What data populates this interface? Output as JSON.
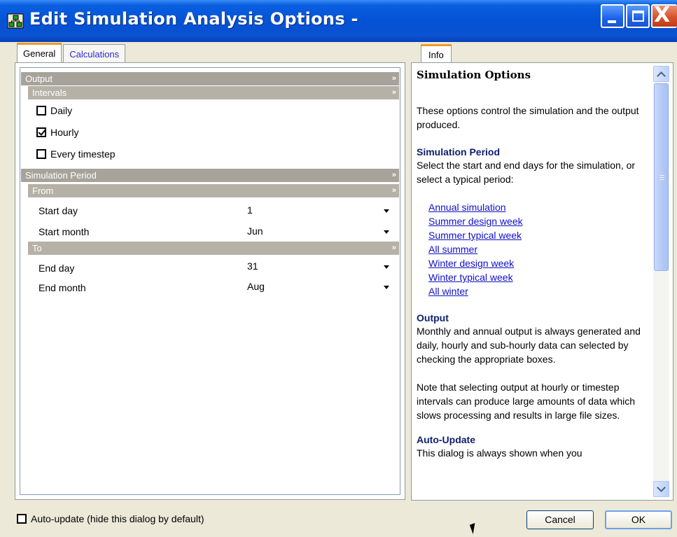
{
  "window": {
    "title": "Edit Simulation Analysis Options -",
    "app_icon": "tree-app-icon",
    "controls": {
      "minimize": "minimize-icon",
      "maximize": "maximize-icon",
      "close_glyph": "X"
    }
  },
  "tabs": [
    {
      "label": "General",
      "active": true
    },
    {
      "label": "Calculations",
      "active": false
    }
  ],
  "options": {
    "output_header": "Output",
    "intervals_header": "Intervals",
    "intervals": [
      {
        "label": "Daily",
        "checked": false
      },
      {
        "label": "Hourly",
        "checked": true
      },
      {
        "label": "Every timestep",
        "checked": false
      }
    ],
    "simulation_period_header": "Simulation Period",
    "from_header": "From",
    "start_day_label": "Start day",
    "start_day_value": "1",
    "start_month_label": "Start month",
    "start_month_value": "Jun",
    "to_header": "To",
    "end_day_label": "End day",
    "end_day_value": "31",
    "end_month_label": "End month",
    "end_month_value": "Aug",
    "collapse_glyph": "»"
  },
  "info": {
    "tab_label": "Info",
    "title": "Simulation Options",
    "intro": "These options control the simulation and the output produced.",
    "period_heading": "Simulation Period",
    "period_text": "Select the start and end days for the simulation, or select a typical period:",
    "period_links": [
      "Annual simulation",
      "Summer design week",
      "Summer typical week",
      "All summer",
      "Winter design week",
      "Winter typical week",
      "All winter"
    ],
    "output_heading": "Output",
    "output_text": "Monthly and annual output is always generated and daily, hourly and sub-hourly data can selected by checking the appropriate boxes.",
    "note_text": "Note that selecting output at hourly or timestep intervals can produce large amounts of data which slows processing and results in large file sizes.",
    "autoupdate_heading": "Auto-Update",
    "autoupdate_text": "This dialog is always shown when you"
  },
  "footer": {
    "auto_update_label": "Auto-update (hide this dialog by default)",
    "auto_update_checked": false,
    "cancel_label": "Cancel",
    "ok_label": "OK"
  },
  "colors": {
    "titlebar": "#0452d6",
    "group_header": "#a7a39a",
    "tab_accent": "#ee9a29",
    "link": "#1010c8",
    "heading": "#0b1f6c",
    "dialog_bg": "#ece9d8"
  }
}
